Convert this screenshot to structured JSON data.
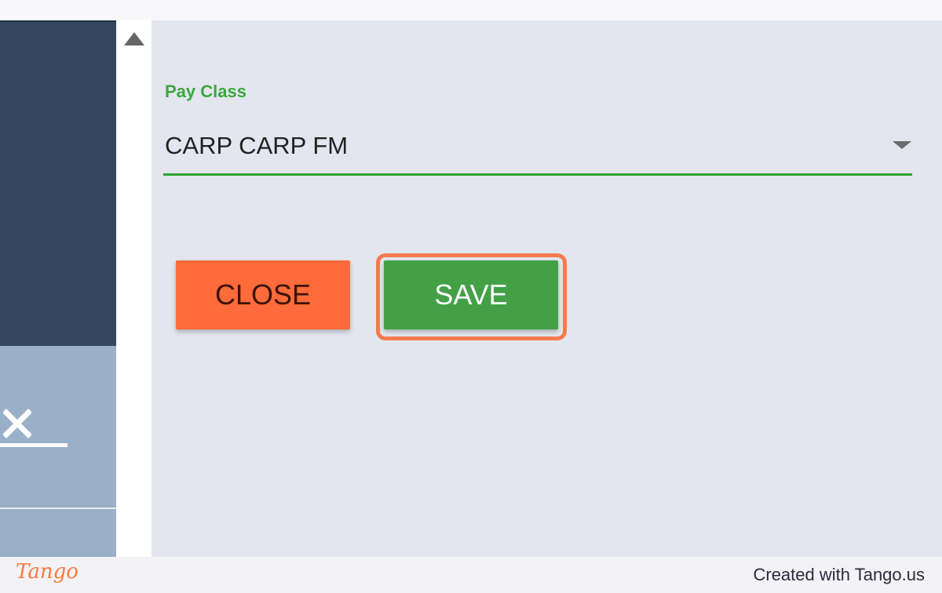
{
  "form": {
    "pay_class_label": "Pay Class",
    "pay_class_value": "CARP CARP FM"
  },
  "actions": {
    "close_label": "CLOSE",
    "save_label": "SAVE"
  },
  "footer": {
    "logo_text": "Tango",
    "credit_text": "Created with Tango.us"
  },
  "icons": {
    "close": "close-icon",
    "scroll_up": "scroll-up-arrow-icon",
    "dropdown": "chevron-down-icon"
  },
  "colors": {
    "accent_green": "#43a047",
    "label_green": "#3aa83d",
    "close_orange": "#ff6b3a",
    "highlight": "#f47a4d",
    "sidebar_dark": "#33475e",
    "sidebar_light": "#9aafc8"
  }
}
